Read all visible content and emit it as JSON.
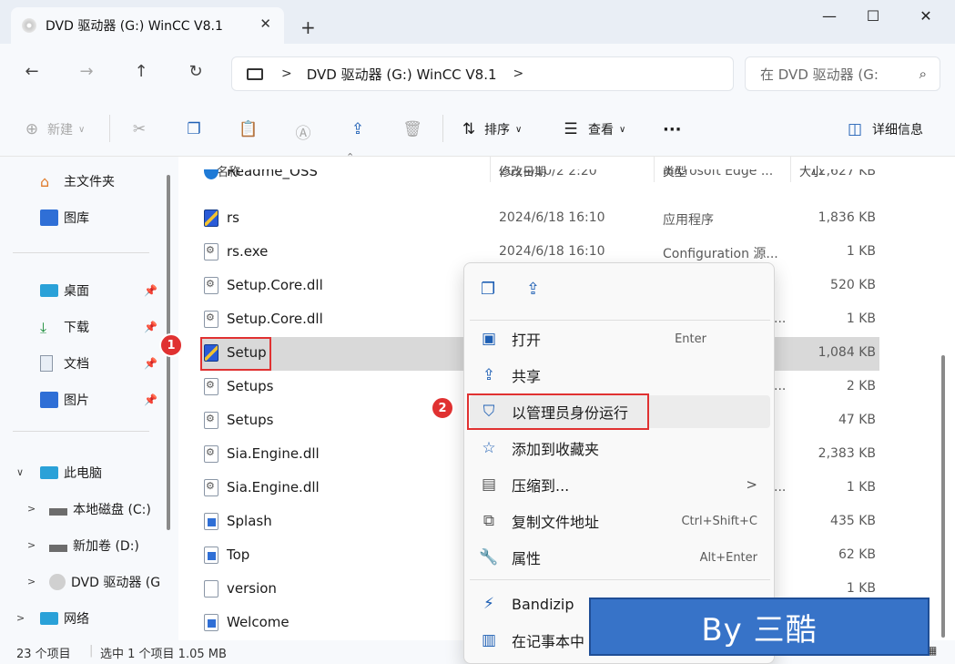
{
  "window": {
    "tab_title": "DVD 驱动器 (G:) WinCC V8.1",
    "close_tab": "✕",
    "new_tab": "+",
    "minimize": "—",
    "maximize": "☐",
    "close": "✕"
  },
  "address": {
    "path": "DVD 驱动器 (G:) WinCC V8.1",
    "search_placeholder": "在 DVD 驱动器 (G:"
  },
  "toolbar": {
    "new_label": "新建",
    "sort_label": "排序",
    "view_label": "查看",
    "more_label": "···",
    "details_label": "详细信息"
  },
  "sidebar": {
    "home": "主文件夹",
    "gallery": "图库",
    "desktop": "桌面",
    "downloads": "下载",
    "documents": "文档",
    "pictures": "图片",
    "this_pc": "此电脑",
    "drive_c": "本地磁盘 (C:)",
    "drive_d": "新加卷 (D:)",
    "drive_g": "DVD 驱动器 (G",
    "network": "网络"
  },
  "columns": {
    "name": "名称",
    "date": "修改日期",
    "type": "类型",
    "size": "大小"
  },
  "files": [
    {
      "name": "Readme_OSS",
      "date": "2024/10/2 2:20",
      "type": "Microsoft Edge ...",
      "size": "12,627 KB"
    },
    {
      "name": "rs",
      "date": "2024/6/18 16:10",
      "type": "应用程序",
      "size": "1,836 KB"
    },
    {
      "name": "rs.exe",
      "date": "2024/6/18 16:10",
      "type": "Configuration 源...",
      "size": "1 KB"
    },
    {
      "name": "Setup.Core.dll",
      "date": "",
      "type": "",
      "size": "520 KB"
    },
    {
      "name": "Setup.Core.dll",
      "date": "",
      "type": "...",
      "size": "1 KB"
    },
    {
      "name": "Setup",
      "date": "",
      "type": "",
      "size": "1,084 KB"
    },
    {
      "name": "Setups",
      "date": "",
      "type": "...",
      "size": "2 KB"
    },
    {
      "name": "Setups",
      "date": "",
      "type": "",
      "size": "47 KB"
    },
    {
      "name": "Sia.Engine.dll",
      "date": "",
      "type": "",
      "size": "2,383 KB"
    },
    {
      "name": "Sia.Engine.dll",
      "date": "",
      "type": "...",
      "size": "1 KB"
    },
    {
      "name": "Splash",
      "date": "",
      "type": "",
      "size": "435 KB"
    },
    {
      "name": "Top",
      "date": "",
      "type": "",
      "size": "62 KB"
    },
    {
      "name": "version",
      "date": "",
      "type": "",
      "size": "1 KB"
    },
    {
      "name": "Welcome",
      "date": "",
      "type": "",
      "size": ""
    }
  ],
  "menu": {
    "open": "打开",
    "open_sc": "Enter",
    "share": "共享",
    "run_admin": "以管理员身份运行",
    "favorite": "添加到收藏夹",
    "compress": "压缩到...",
    "copy_path": "复制文件地址",
    "copy_path_sc": "Ctrl+Shift+C",
    "properties": "属性",
    "properties_sc": "Alt+Enter",
    "bandizip": "Bandizip",
    "notepad": "在记事本中"
  },
  "status": {
    "count": "23 个项目",
    "selected": "选中 1 个项目  1.05 MB"
  },
  "annotations": {
    "badge1": "1",
    "badge2": "2",
    "watermark": "By 三酷"
  },
  "colors": {
    "accent": "#1e5fb4",
    "annotation_red": "#e03131",
    "watermark_bg": "#3773c8"
  }
}
